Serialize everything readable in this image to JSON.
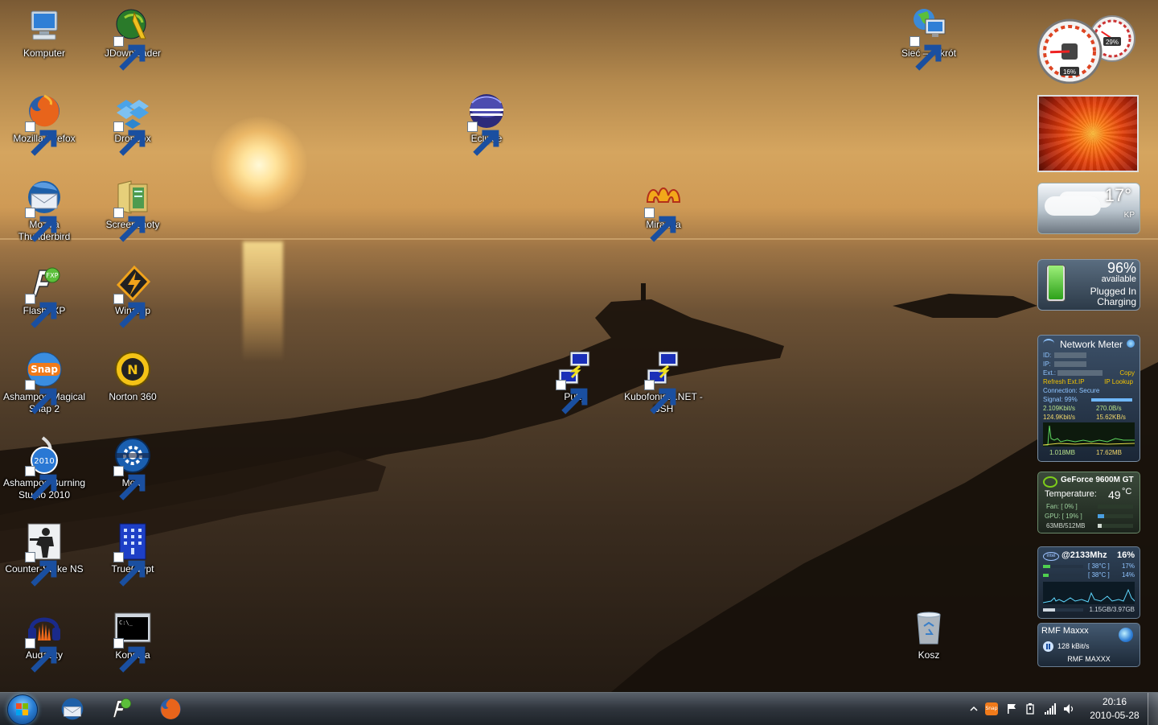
{
  "desktop": {
    "icons": [
      {
        "id": "komputer",
        "label": "Komputer"
      },
      {
        "id": "jdownloader",
        "label": "JDownloader"
      },
      {
        "id": "firefox",
        "label": "Mozilla Firefox"
      },
      {
        "id": "dropbox",
        "label": "Dropbox"
      },
      {
        "id": "eclipse",
        "label": "Eclipse"
      },
      {
        "id": "thunderbird",
        "label": "Mozilla Thunderbird"
      },
      {
        "id": "screenshoty",
        "label": "Screenshoty"
      },
      {
        "id": "miranda",
        "label": "Miranda"
      },
      {
        "id": "flashfxp",
        "label": "FlashFXP"
      },
      {
        "id": "winamp",
        "label": "Winamp"
      },
      {
        "id": "snap",
        "label": "Ashampoo Magical Snap 2"
      },
      {
        "id": "norton",
        "label": "Norton 360"
      },
      {
        "id": "putty",
        "label": "Putty"
      },
      {
        "id": "kubofonista",
        "label": "Kubofonista.NET - SSH"
      },
      {
        "id": "burning",
        "label": "Ashampoo Burning Studio 2010"
      },
      {
        "id": "mom",
        "label": "MoM"
      },
      {
        "id": "counterstrike",
        "label": "Counter-Strike NS"
      },
      {
        "id": "truecrypt",
        "label": "TrueCrypt"
      },
      {
        "id": "audacity",
        "label": "Audacity"
      },
      {
        "id": "konsola",
        "label": "Konsola"
      },
      {
        "id": "kosz",
        "label": "Kosz"
      },
      {
        "id": "siec",
        "label": "Sieć — skrót"
      }
    ]
  },
  "gadgets": {
    "cpu_meter": {
      "cpu": "16%",
      "memory": "29%",
      "cpu_level": 0.16,
      "memory_level": 0.29
    },
    "weather": {
      "temp": "17°",
      "location": "KP"
    },
    "battery": {
      "percent": "96%",
      "available": "available",
      "status1": "Plugged In",
      "status2": "Charging",
      "level": 0.96
    },
    "network_meter": {
      "title": "Network Meter",
      "id_label": "ID:",
      "ip_label": "IP:",
      "ext_label": "Ext.:",
      "copy": "Copy",
      "refresh": "Refresh Ext.IP",
      "ip_lookup": "IP Lookup",
      "connection": "Connection: Secure",
      "signal": "Signal: 99%",
      "signal_level": 0.99,
      "up_rate": "2.109Kbit/s",
      "up_bytes": "270.0B/s",
      "down_rate": "124.9Kbit/s",
      "down_bytes": "15.62KB/s",
      "up_total": "1.018MB",
      "down_total": "17.62MB"
    },
    "gpu": {
      "name": "GeForce 9600M GT",
      "temp_label": "Temperature:",
      "temp": "49",
      "unit": "°C",
      "fan": "Fan: [ 0% ]",
      "gpu_load": "GPU: [ 19% ]",
      "memory": "63MB/512MB",
      "fan_level": 0.0,
      "gpu_level": 0.19,
      "mem_level": 0.12
    },
    "cpu_monitor": {
      "brand": "intel",
      "freq": "@2133Mhz",
      "total": "16%",
      "core1_temp": "[ 38°C ]",
      "core1_load": "17%",
      "core2_temp": "[ 38°C ]",
      "core2_load": "14%",
      "core1_level": 0.17,
      "core2_level": 0.14,
      "ram": "1.15GB/3.97GB",
      "ram_level": 0.29
    },
    "radio": {
      "title": "RMF Maxxx",
      "bitrate": "128 kBit/s",
      "station": "RMF MAXXX"
    }
  },
  "taskbar": {
    "pinned": [
      "thunderbird",
      "flashfxp",
      "firefox"
    ],
    "clock_time": "20:16",
    "clock_date": "2010-05-28",
    "tray": [
      "show-hidden-icons",
      "snap",
      "action-center",
      "power",
      "network",
      "volume"
    ]
  }
}
